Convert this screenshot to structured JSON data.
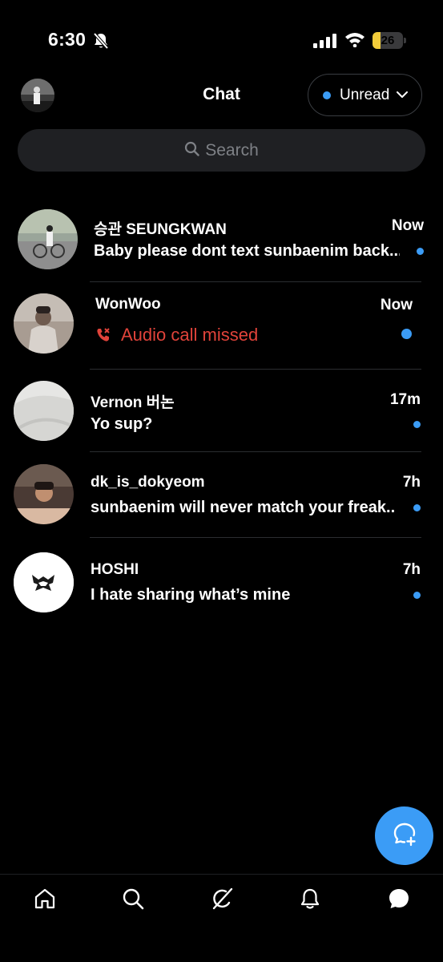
{
  "status_bar": {
    "time": "6:30",
    "battery": "26",
    "battery_level": 0.26
  },
  "header": {
    "title": "Chat",
    "filter_label": "Unread"
  },
  "search": {
    "placeholder": "Search"
  },
  "conversations": [
    {
      "name": "승관 SEUNGKWAN",
      "time": "Now",
      "preview": "Baby please dont text sunbaenim back...",
      "unread": true
    },
    {
      "name": "WonWoo",
      "time": "Now",
      "preview": "Audio call missed",
      "type": "missed-call",
      "unread": true
    },
    {
      "name": "Vernon 버논",
      "time": "17m",
      "preview": "Yo sup?",
      "unread": true
    },
    {
      "name": "dk_is_dokyeom",
      "time": "7h",
      "preview": "sunbaenim will never match your freak...",
      "unread": true
    },
    {
      "name": "HOSHI",
      "time": "7h",
      "preview": "I hate sharing what’s mine",
      "unread": true
    }
  ],
  "icons": {
    "status": [
      "bell-off-icon",
      "signal-icon",
      "wifi-icon",
      "battery-icon"
    ],
    "header": [
      "profile-avatar",
      "chevron-down-icon",
      "search-icon"
    ],
    "fab": "new-message-icon",
    "tabs": [
      "home-icon",
      "search-icon",
      "grok-icon",
      "notifications-icon",
      "messages-icon"
    ]
  },
  "colors": {
    "accent": "#3b9cf6",
    "missed": "#e0433a",
    "background": "#000000",
    "search_bg": "#1f2023"
  }
}
